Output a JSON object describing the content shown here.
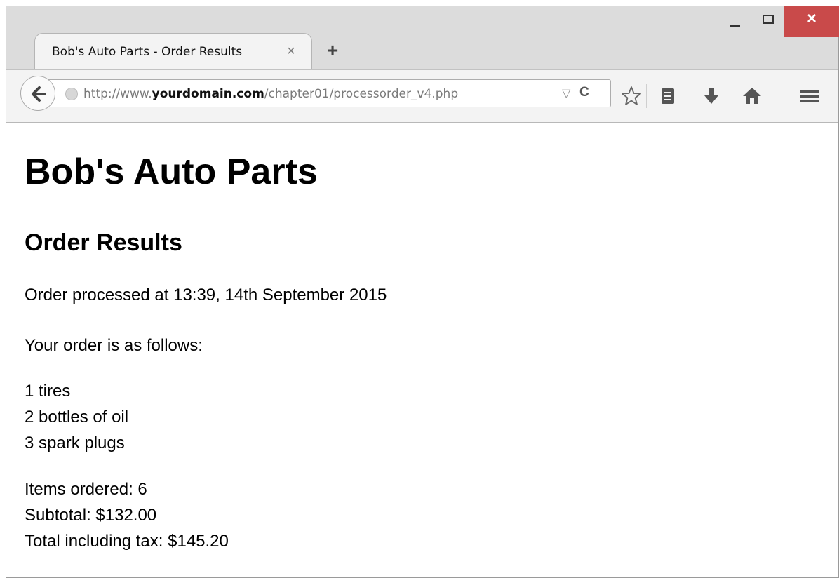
{
  "browser": {
    "tab_title": "Bob's Auto Parts - Order Results",
    "tab_close": "×",
    "new_tab": "+",
    "url_prefix": "http://www.",
    "url_domain": "yourdomain.com",
    "url_path": "/chapter01/processorder_v4.php",
    "dropmarker": "▽",
    "reload": "C",
    "close_glyph": "×",
    "icons": [
      "back-arrow-icon",
      "globe-icon",
      "dropmarker-icon",
      "reload-icon",
      "bookmark-star-icon",
      "reading-list-icon",
      "download-icon",
      "home-icon",
      "menu-icon"
    ],
    "colors": {
      "close_button": "#c94a4a",
      "tab_bg": "#f3f3f3",
      "chrome_bg": "#dcdcdc"
    }
  },
  "page": {
    "heading": "Bob's Auto Parts",
    "subheading": "Order Results",
    "processed": "Order processed at 13:39, 14th September 2015",
    "intro": "Your order is as follows:",
    "items": [
      "1 tires",
      "2 bottles of oil",
      "3 spark plugs"
    ],
    "summary": [
      "Items ordered: 6",
      "Subtotal: $132.00",
      "Total including tax: $145.20"
    ]
  }
}
